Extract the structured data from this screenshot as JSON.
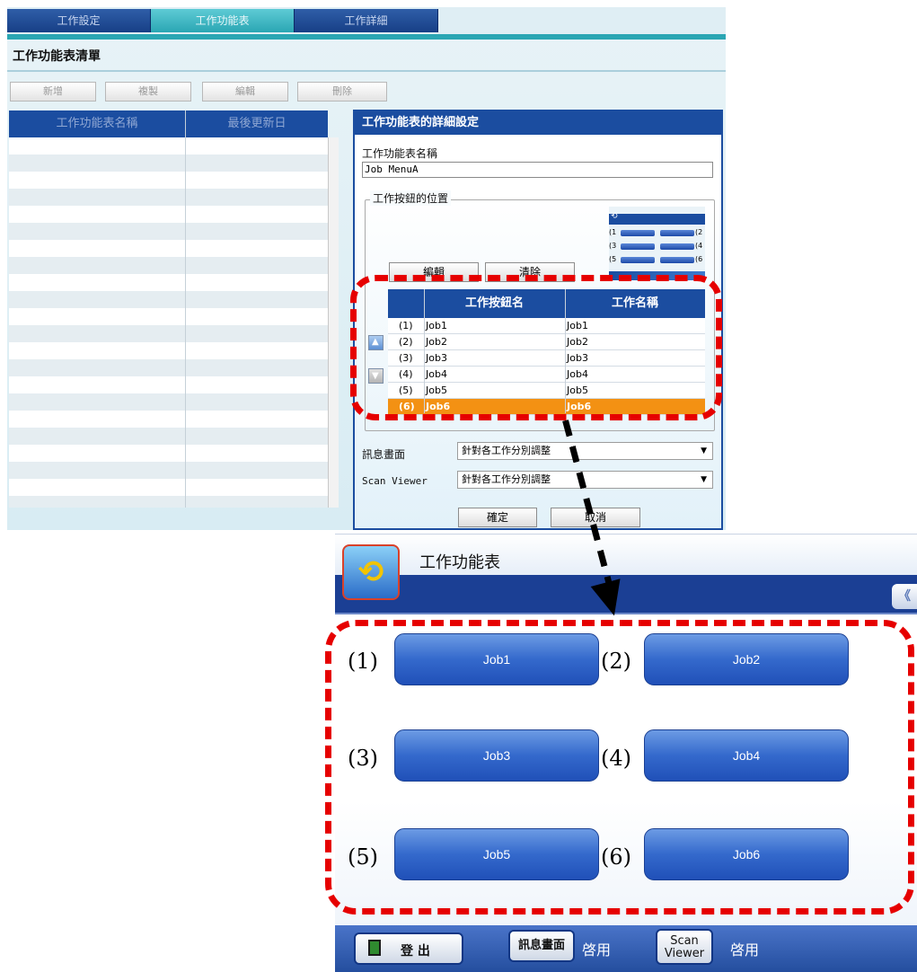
{
  "admin": {
    "tabs": [
      "工作設定",
      "工作功能表",
      "工作詳細"
    ],
    "active_tab": 1,
    "list_title": "工作功能表清單",
    "toolbar": {
      "add": "新增",
      "copy": "複製",
      "edit": "編輯",
      "delete": "刪除"
    },
    "list_columns": {
      "name": "工作功能表名稱",
      "updated": "最後更新日"
    }
  },
  "detail": {
    "header": "工作功能表的詳細設定",
    "name_label": "工作功能表名稱",
    "name_value": "Job MenuA",
    "position_legend": "工作按鈕的位置",
    "edit_button": "編輯",
    "clear_button": "清除",
    "mini_labels": [
      "(1",
      "(2",
      "(3",
      "(4",
      "(5",
      "(6"
    ],
    "table_columns": {
      "button": "工作按鈕名",
      "job": "工作名稱"
    },
    "rows": [
      {
        "num": "(1)",
        "button": "Job1",
        "job": "Job1"
      },
      {
        "num": "(2)",
        "button": "Job2",
        "job": "Job2"
      },
      {
        "num": "(3)",
        "button": "Job3",
        "job": "Job3"
      },
      {
        "num": "(4)",
        "button": "Job4",
        "job": "Job4"
      },
      {
        "num": "(5)",
        "button": "Job5",
        "job": "Job5"
      },
      {
        "num": "(6)",
        "button": "Job6",
        "job": "Job6"
      }
    ],
    "selected_row": 5,
    "message_label": "訊息畫面",
    "message_value": "針對各工作分別調整",
    "viewer_label": "Scan Viewer",
    "viewer_value": "針對各工作分別調整",
    "ok": "確定",
    "cancel": "取消"
  },
  "op": {
    "title": "工作功能表",
    "toggle": "《",
    "buttons": [
      {
        "num": "(1)",
        "label": "Job1"
      },
      {
        "num": "(2)",
        "label": "Job2"
      },
      {
        "num": "(3)",
        "label": "Job3"
      },
      {
        "num": "(4)",
        "label": "Job4"
      },
      {
        "num": "(5)",
        "label": "Job5"
      },
      {
        "num": "(6)",
        "label": "Job6"
      }
    ],
    "logout": "登 出",
    "message_button": "訊息畫面",
    "message_state": "啓用",
    "viewer_line1": "Scan",
    "viewer_line2": "Viewer",
    "viewer_state": "啓用"
  },
  "colors": {
    "accent": "#1b4da0",
    "selected": "#f39113",
    "highlight": "#e60000"
  }
}
